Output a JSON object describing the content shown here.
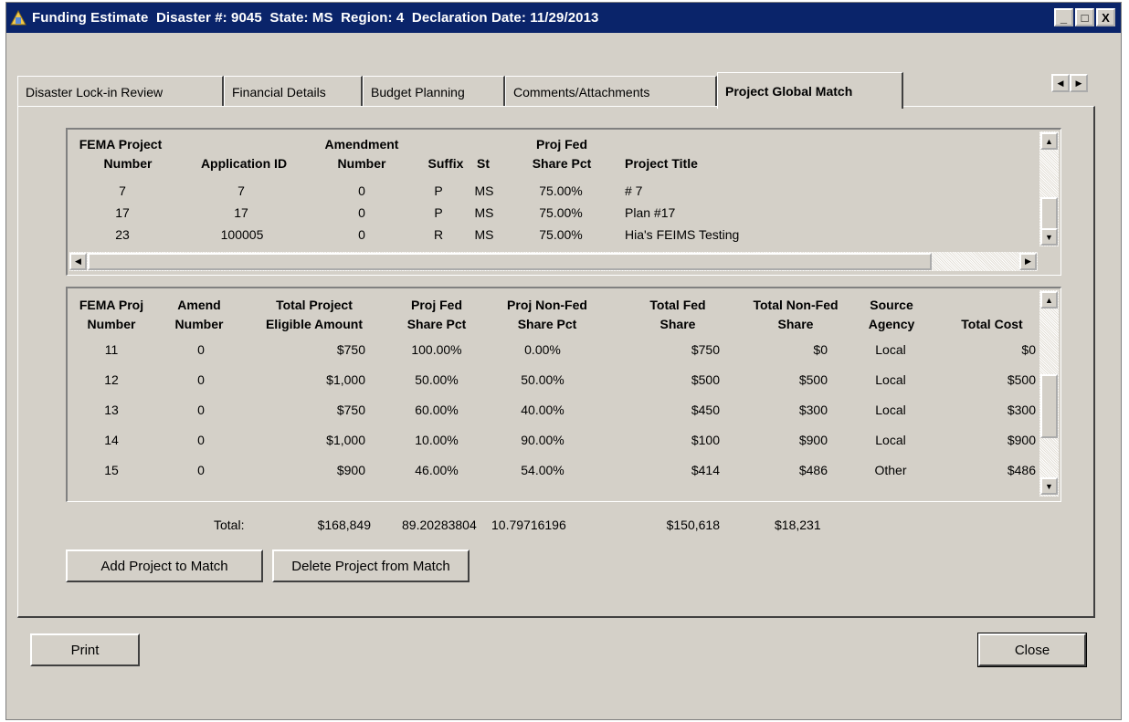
{
  "window": {
    "title": "Funding Estimate  Disaster #: 9045  State: MS  Region: 4  Declaration Date: 11/29/2013",
    "minimize": "_",
    "maximize": "□",
    "close": "X"
  },
  "tabs": [
    {
      "label": "Disaster Lock-in Review"
    },
    {
      "label": "Financial Details"
    },
    {
      "label": "Budget Planning"
    },
    {
      "label": "Comments/Attachments"
    },
    {
      "label": "Project Global Match"
    }
  ],
  "active_tab": "Project Global Match",
  "projects_grid": {
    "headers": {
      "fema_project_number": [
        "FEMA Project",
        "Number"
      ],
      "application_id": "Application ID",
      "amendment_number": [
        "Amendment",
        "Number"
      ],
      "suffix": "Suffix",
      "st": "St",
      "proj_fed_share_pct": [
        "Proj Fed",
        "Share Pct"
      ],
      "project_title": "Project Title"
    },
    "rows": [
      {
        "fema": "7",
        "app": "7",
        "amend": "0",
        "suffix": "P",
        "st": "MS",
        "pct": "75.00%",
        "title": "# 7"
      },
      {
        "fema": "17",
        "app": "17",
        "amend": "0",
        "suffix": "P",
        "st": "MS",
        "pct": "75.00%",
        "title": "Plan #17"
      },
      {
        "fema": "23",
        "app": "100005",
        "amend": "0",
        "suffix": "R",
        "st": "MS",
        "pct": "75.00%",
        "title": "Hia's FEIMS Testing"
      }
    ]
  },
  "match_grid": {
    "headers": {
      "fema_proj_number": [
        "FEMA Proj",
        "Number"
      ],
      "amend_number": [
        "Amend",
        "Number"
      ],
      "total_project_eligible": [
        "Total Project",
        "Eligible Amount"
      ],
      "proj_fed_share_pct": [
        "Proj Fed",
        "Share Pct"
      ],
      "proj_nonfed_share_pct": [
        "Proj Non-Fed",
        "Share Pct"
      ],
      "total_fed_share": [
        "Total Fed",
        "Share"
      ],
      "total_nonfed_share": [
        "Total Non-Fed",
        "Share"
      ],
      "source_agency": [
        "Source",
        "Agency"
      ],
      "total_cost": "Total Cost"
    },
    "rows": [
      {
        "fema": "11",
        "amend": "0",
        "eligible": "$750",
        "fed_pct": "100.00%",
        "nonfed_pct": "0.00%",
        "fed": "$750",
        "nonfed": "$0",
        "agency": "Local",
        "cost": "$0"
      },
      {
        "fema": "12",
        "amend": "0",
        "eligible": "$1,000",
        "fed_pct": "50.00%",
        "nonfed_pct": "50.00%",
        "fed": "$500",
        "nonfed": "$500",
        "agency": "Local",
        "cost": "$500"
      },
      {
        "fema": "13",
        "amend": "0",
        "eligible": "$750",
        "fed_pct": "60.00%",
        "nonfed_pct": "40.00%",
        "fed": "$450",
        "nonfed": "$300",
        "agency": "Local",
        "cost": "$300"
      },
      {
        "fema": "14",
        "amend": "0",
        "eligible": "$1,000",
        "fed_pct": "10.00%",
        "nonfed_pct": "90.00%",
        "fed": "$100",
        "nonfed": "$900",
        "agency": "Local",
        "cost": "$900"
      },
      {
        "fema": "15",
        "amend": "0",
        "eligible": "$900",
        "fed_pct": "46.00%",
        "nonfed_pct": "54.00%",
        "fed": "$414",
        "nonfed": "$486",
        "agency": "Other",
        "cost": "$486"
      }
    ]
  },
  "totals": {
    "label": "Total:",
    "eligible": "$168,849",
    "fed_pct": "89.20283804",
    "nonfed_pct": "10.79716196",
    "fed": "$150,618",
    "nonfed": "$18,231"
  },
  "buttons": {
    "add": "Add Project to Match",
    "delete": "Delete Project from Match",
    "print": "Print",
    "close": "Close"
  },
  "icons": {
    "scroll_up": "▲",
    "scroll_down": "▼",
    "scroll_left": "◀",
    "scroll_right": "▶"
  }
}
